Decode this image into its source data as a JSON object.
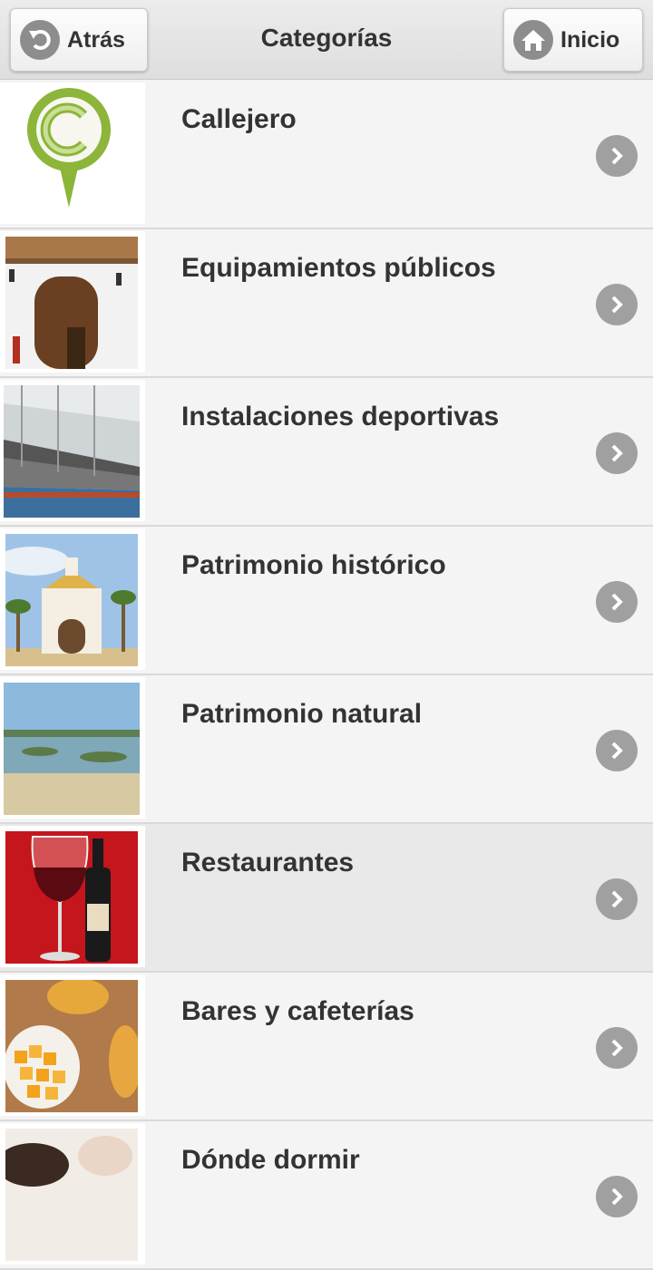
{
  "header": {
    "title": "Categorías",
    "back_label": "Atrás",
    "home_label": "Inicio"
  },
  "categories": [
    {
      "label": "Callejero",
      "icon": "map-pin-c-icon"
    },
    {
      "label": "Equipamientos públicos",
      "icon": "building-door-photo"
    },
    {
      "label": "Instalaciones deportivas",
      "icon": "sports-hall-photo"
    },
    {
      "label": "Patrimonio histórico",
      "icon": "chapel-photo"
    },
    {
      "label": "Patrimonio natural",
      "icon": "marsh-landscape-photo"
    },
    {
      "label": "Restaurantes",
      "icon": "wine-glass-photo"
    },
    {
      "label": "Bares y cafeterías",
      "icon": "beer-cheese-photo"
    },
    {
      "label": "Dónde dormir",
      "icon": "bed-photo"
    }
  ],
  "colors": {
    "accent_green": "#8cb53a",
    "chevron_gray": "#a0a0a0",
    "text": "#333333"
  }
}
